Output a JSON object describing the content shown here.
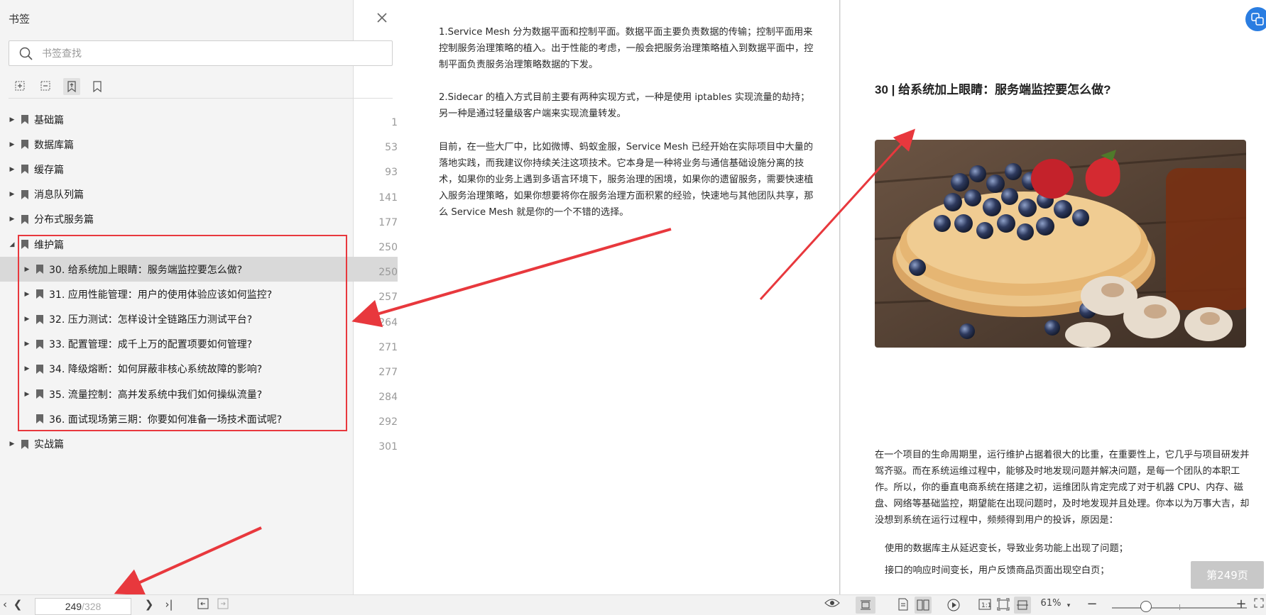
{
  "sidebar": {
    "title": "书签",
    "search_placeholder": "书签查找",
    "items": [
      {
        "label": "基础篇",
        "page": "1",
        "level": 0,
        "expanded": false
      },
      {
        "label": "数据库篇",
        "page": "53",
        "level": 0,
        "expanded": false
      },
      {
        "label": "缓存篇",
        "page": "93",
        "level": 0,
        "expanded": false
      },
      {
        "label": "消息队列篇",
        "page": "141",
        "level": 0,
        "expanded": false
      },
      {
        "label": "分布式服务篇",
        "page": "177",
        "level": 0,
        "expanded": false
      },
      {
        "label": "维护篇",
        "page": "250",
        "level": 0,
        "expanded": true
      },
      {
        "label": "30. 给系统加上眼睛：服务端监控要怎么做?",
        "page": "250",
        "level": 1,
        "selected": true
      },
      {
        "label": "31. 应用性能管理：用户的使用体验应该如何监控?",
        "page": "257",
        "level": 1
      },
      {
        "label": "32. 压力测试：怎样设计全链路压力测试平台?",
        "page": "264",
        "level": 1
      },
      {
        "label": "33. 配置管理：成千上万的配置项要如何管理?",
        "page": "271",
        "level": 1
      },
      {
        "label": "34. 降级熔断：如何屏蔽非核心系统故障的影响?",
        "page": "277",
        "level": 1
      },
      {
        "label": "35. 流量控制：高并发系统中我们如何操纵流量?",
        "page": "284",
        "level": 1
      },
      {
        "label": "36. 面试现场第三期：你要如何准备一场技术面试呢?",
        "page": "292",
        "level": 1,
        "leaf": true
      },
      {
        "label": "实战篇",
        "page": "301",
        "level": 0,
        "expanded": false
      }
    ]
  },
  "left_page": {
    "p1": "1.Service Mesh 分为数据平面和控制平面。数据平面主要负责数据的传输；控制平面用来控制服务治理策略的植入。出于性能的考虑，一般会把服务治理策略植入到数据平面中，控制平面负责服务治理策略数据的下发。",
    "p2": "2.Sidecar 的植入方式目前主要有两种实现方式，一种是使用 iptables 实现流量的劫持；另一种是通过轻量级客户端来实现流量转发。",
    "p3": "目前，在一些大厂中，比如微博、蚂蚁金服，Service Mesh 已经开始在实际项目中大量的落地实践，而我建议你持续关注这项技术。它本身是一种将业务与通信基础设施分离的技术，如果你的业务上遇到多语言环境下，服务治理的困境，如果你的遗留服务，需要快速植入服务治理策略，如果你想要将你在服务治理方面积累的经验，快速地与其他团队共享，那么 Service Mesh 就是你的一个不错的选择。"
  },
  "right_page": {
    "heading": "30 | 给系统加上眼睛：服务端监控要怎么做?",
    "p1": "在一个项目的生命周期里，运行维护占据着很大的比重，在重要性上，它几乎与项目研发并驾齐驱。而在系统运维过程中，能够及时地发现问题并解决问题，是每一个团队的本职工作。所以，你的垂直电商系统在搭建之初，运维团队肯定完成了对于机器 CPU、内存、磁盘、网络等基础监控，期望能在出现问题时，及时地发现并且处理。你本以为万事大吉，却没想到系统在运行过程中，频频得到用户的投诉，原因是：",
    "b1": "使用的数据库主从延迟变长，导致业务功能上出现了问题；",
    "b2": "接口的响应时间变长，用户反馈商品页面出现空白页；"
  },
  "page_indicator": "第249页",
  "statusbar": {
    "current_page": "249",
    "total_pages": "/328",
    "zoom": "61%",
    "zoom_level": 0.25
  },
  "colors": {
    "accent": "#2a7de1",
    "annotation": "#e8383d",
    "selected_row": "#d9d9d9"
  }
}
